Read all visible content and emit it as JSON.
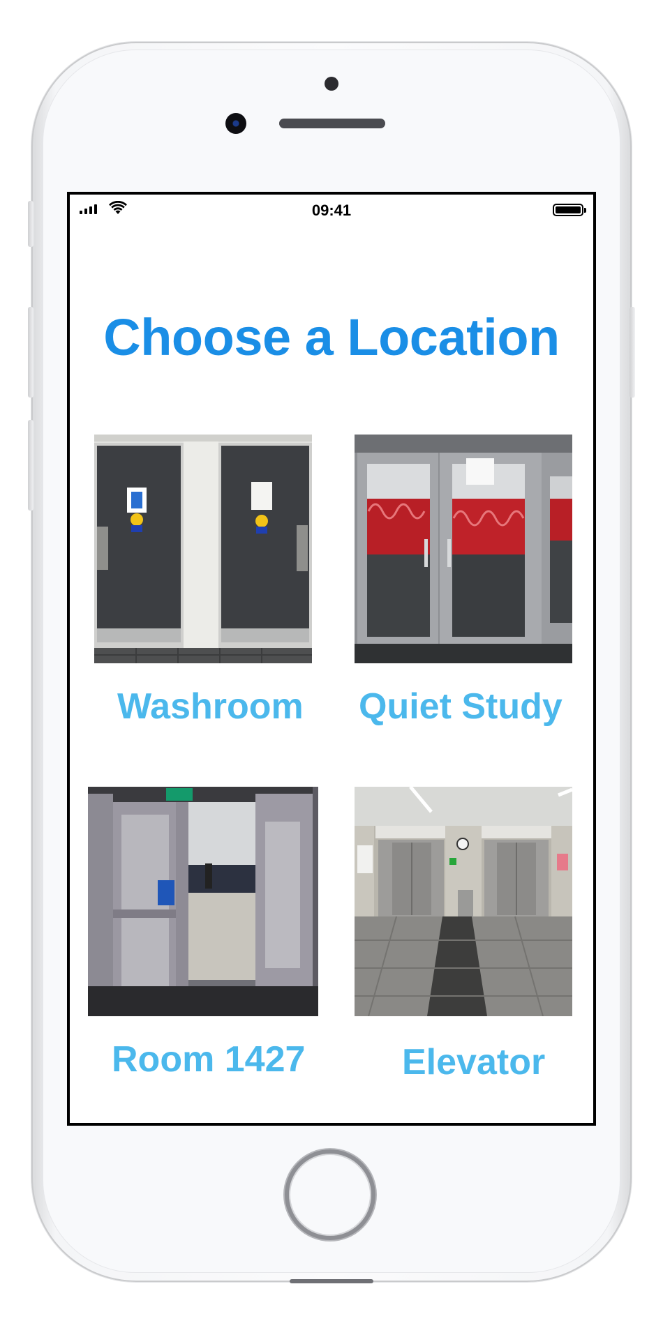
{
  "status_bar": {
    "time": "09:41"
  },
  "screen": {
    "title": "Choose a Location",
    "title_color": "#1a8ee6",
    "label_color": "#4bb8ec",
    "locations": [
      {
        "label": "Washroom",
        "photo": "washroom-doors-photo"
      },
      {
        "label": "Quiet Study",
        "photo": "quiet-study-doors-photo"
      },
      {
        "label": "Room 1427",
        "photo": "room-1427-doors-photo"
      },
      {
        "label": "Elevator",
        "photo": "elevator-lobby-photo"
      }
    ]
  }
}
